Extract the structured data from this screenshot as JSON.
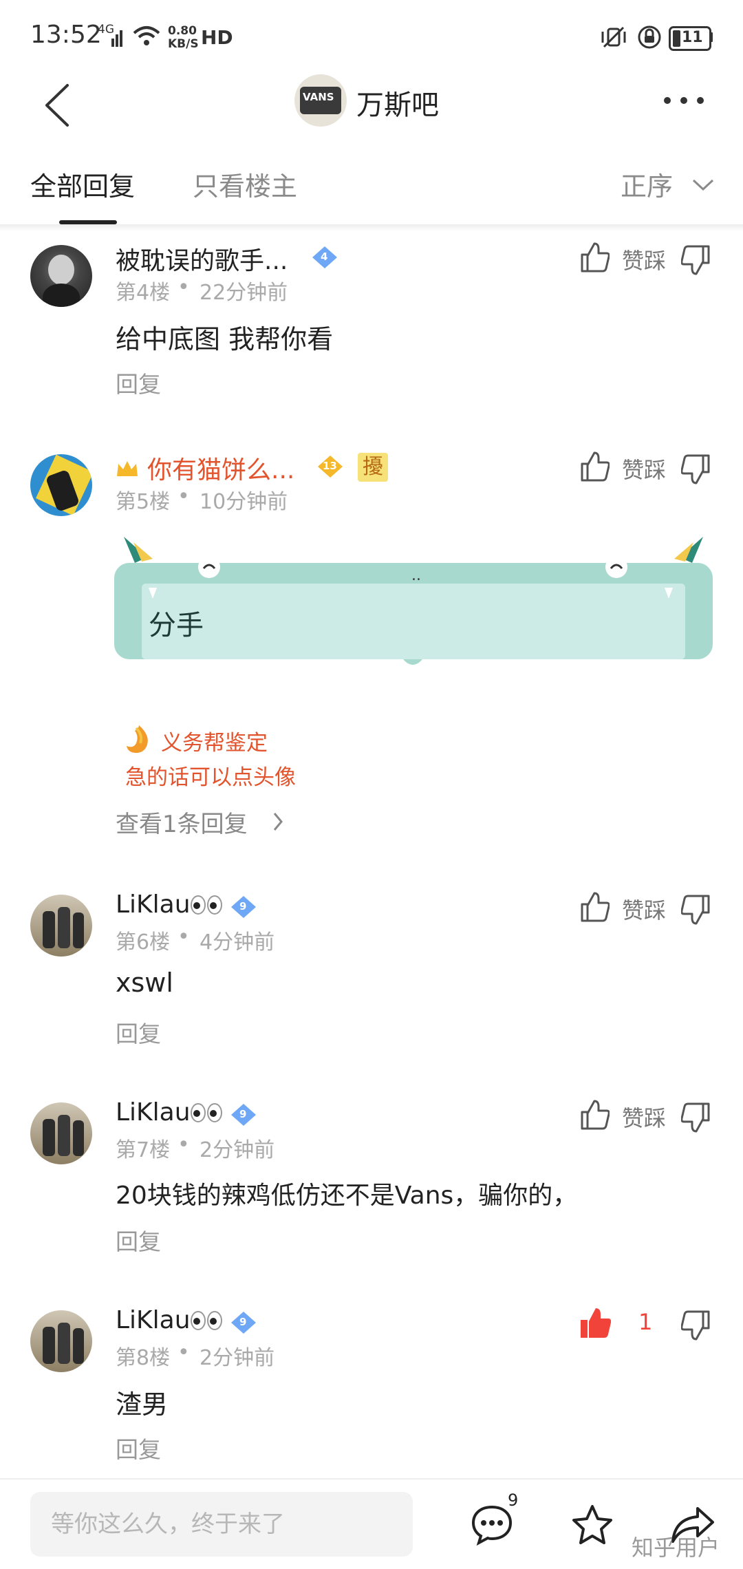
{
  "status_bar": {
    "time": "13:52",
    "network_type": "4G",
    "net_speed_value": "0.80",
    "net_speed_unit": "KB/S",
    "hd": "HD",
    "battery": "11"
  },
  "header": {
    "forum_name": "万斯吧",
    "forum_logo_text": "VANS"
  },
  "tabs": {
    "all_replies": "全部回复",
    "op_only": "只看楼主",
    "sort_label": "正序"
  },
  "comments": [
    {
      "username": "被耽误的歌手...",
      "level": "4",
      "floor": "第4楼",
      "time": "22分钟前",
      "content": "给中底图  我帮你看",
      "reply_label": "回复",
      "vote_label": "赞踩"
    },
    {
      "username": "你有猫饼么...",
      "level": "13",
      "special_badge": "擾",
      "floor": "第5楼",
      "time": "10分钟前",
      "bubble_text": "分手",
      "bubble_dots": "..",
      "gift_line1": "义务帮鉴定",
      "gift_line2": "急的话可以点头像",
      "more_replies": "查看1条回复",
      "vote_label": "赞踩"
    },
    {
      "username": "LiKlau",
      "level": "9",
      "floor": "第6楼",
      "time": "4分钟前",
      "content": "xswl",
      "reply_label": "回复",
      "vote_label": "赞踩"
    },
    {
      "username": "LiKlau",
      "level": "9",
      "floor": "第7楼",
      "time": "2分钟前",
      "content": "20块钱的辣鸡低仿还不是Vans，骗你的，",
      "reply_label": "回复",
      "vote_label": "赞踩"
    },
    {
      "username": "LiKlau",
      "level": "9",
      "floor": "第8楼",
      "time": "2分钟前",
      "content": "渣男",
      "reply_label": "回复",
      "like_count": "1",
      "liked": true
    }
  ],
  "bottom_bar": {
    "input_placeholder": "等你这么久，终于来了",
    "comment_count": "9"
  },
  "watermark": "知乎用户",
  "icons": {
    "back": "back-arrow-icon",
    "more": "more-dots-icon",
    "like": "thumb-up-icon",
    "dislike": "thumb-down-icon",
    "comment": "comment-bubble-icon",
    "favorite": "star-icon",
    "share": "share-arrow-icon"
  },
  "colors": {
    "accent_red": "#f2433a",
    "username_red": "#e2542d",
    "level_blue": "#6ea7f5",
    "level_gold": "#f5b82a",
    "bubble_teal": "#a8d9cf"
  }
}
